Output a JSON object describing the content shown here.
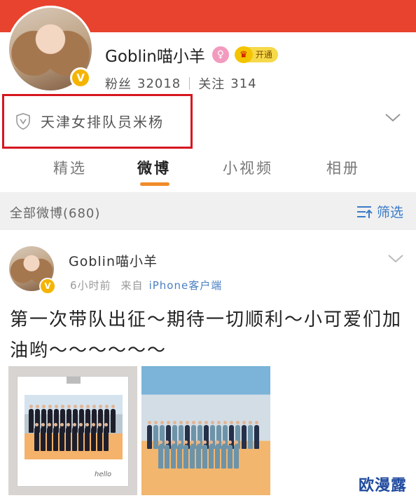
{
  "profile": {
    "username": "Goblin喵小羊",
    "verified_badge": "V",
    "gender_icon": "female-icon",
    "vip_label": "开通",
    "followers_label": "粉丝",
    "followers_count": "32018",
    "following_label": "关注",
    "following_count": "314",
    "certification": "天津女排队员米杨"
  },
  "tabs": [
    {
      "label": "精选",
      "active": false
    },
    {
      "label": "微博",
      "active": true
    },
    {
      "label": "小视频",
      "active": false
    },
    {
      "label": "相册",
      "active": false
    }
  ],
  "feed": {
    "title": "全部微博(680)",
    "filter_label": "筛选"
  },
  "post": {
    "author": "Goblin喵小羊",
    "verified_badge": "V",
    "time": "6小时前",
    "from_label": "来自",
    "client": "iPhone客户端",
    "text": "第一次带队出征～期待一切顺利～小可爱们加油哟～～～～～～",
    "photo1_signature": "hello"
  },
  "watermark": "欧漫露",
  "colors": {
    "banner": "#e8432f",
    "highlight_box": "#d6161f",
    "tab_underline": "#f08c2a",
    "link_blue": "#3b7bc8",
    "verified_gold": "#f5b400"
  }
}
